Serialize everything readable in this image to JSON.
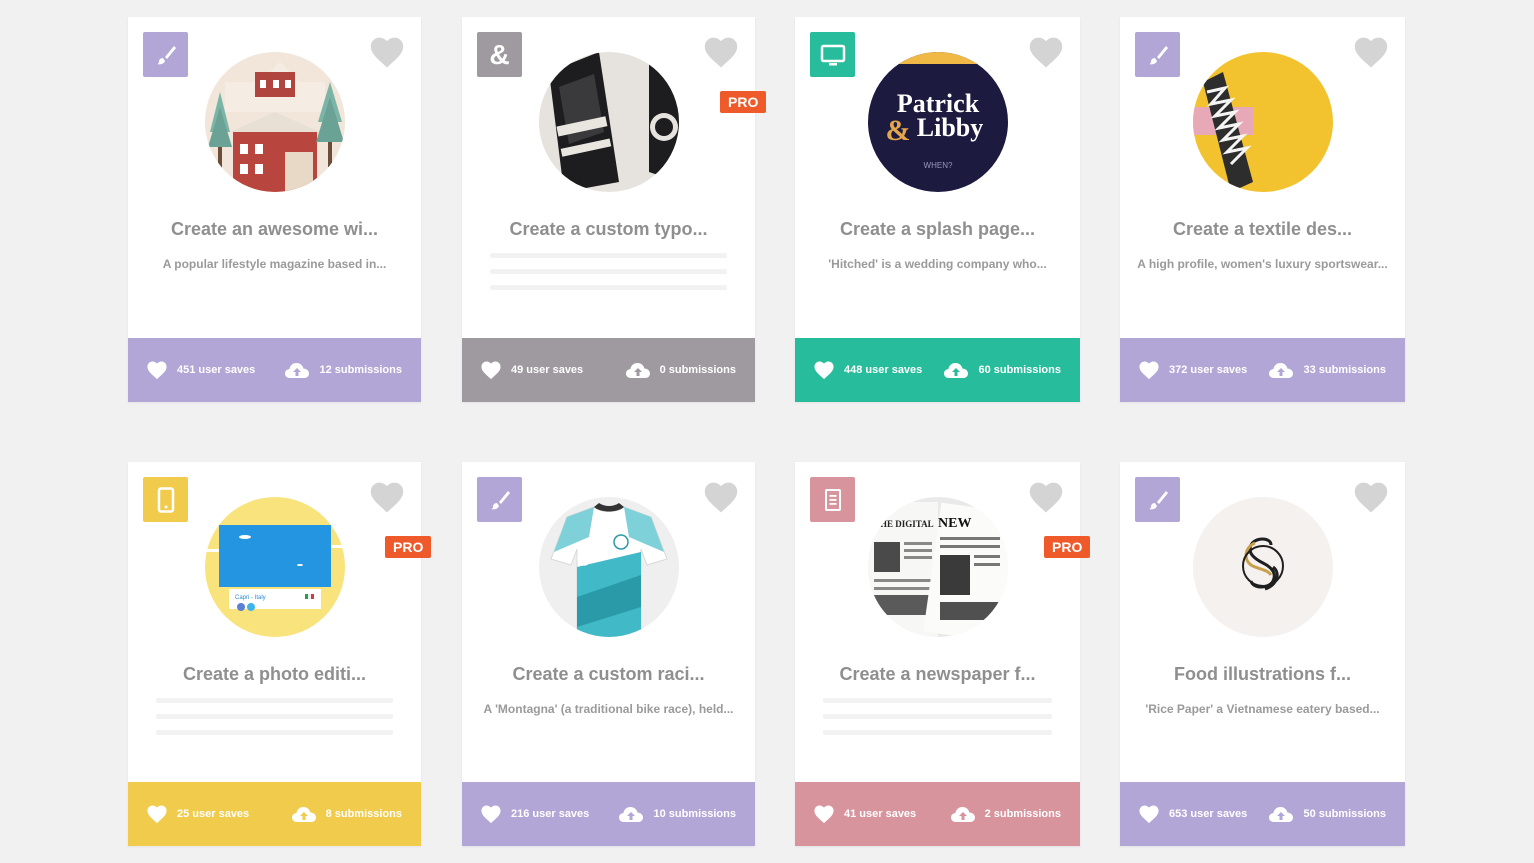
{
  "colors": {
    "purple": "#b2a6d6",
    "gray": "#9e9a9f",
    "teal": "#27bc9b",
    "yellow": "#f1cb4b",
    "pink": "#d7949d",
    "pro_badge": "#ef5a2a",
    "heart_gray": "#d4d4d4"
  },
  "cards": [
    {
      "category": "illustration",
      "category_icon": "brush-icon",
      "title": "Create an awesome wi...",
      "description": "A popular lifestyle magazine based in...",
      "saves": "451 user saves",
      "submissions": "12 submissions",
      "pro": "",
      "color": "purple"
    },
    {
      "category": "typography",
      "category_icon": "ampersand-icon",
      "title": "Create a custom typo...",
      "description": "",
      "saves": "49 user saves",
      "submissions": "0 submissions",
      "pro": "PRO",
      "color": "gray"
    },
    {
      "category": "web",
      "category_icon": "monitor-icon",
      "title": "Create a splash page...",
      "description": "'Hitched' is a wedding company who...",
      "saves": "448 user saves",
      "submissions": "60 submissions",
      "pro": "",
      "color": "teal",
      "thumb_text": {
        "line1": "Patrick",
        "amp": "&",
        "line2": "Libby",
        "small": "WHEN?"
      }
    },
    {
      "category": "illustration",
      "category_icon": "brush-icon",
      "title": "Create a textile des...",
      "description": "A high profile, women's luxury sportswear...",
      "saves": "372 user saves",
      "submissions": "33 submissions",
      "pro": "",
      "color": "purple"
    },
    {
      "category": "mobile",
      "category_icon": "phone-icon",
      "title": "Create a photo editi...",
      "description": "",
      "saves": "25 user saves",
      "submissions": "8 submissions",
      "pro": "PRO",
      "color": "yellow",
      "thumb_text": {
        "caption": "Capri - Italy"
      }
    },
    {
      "category": "illustration",
      "category_icon": "brush-icon",
      "title": "Create a custom raci...",
      "description": "A 'Montagna' (a traditional bike race), held...",
      "saves": "216 user saves",
      "submissions": "10 submissions",
      "pro": "",
      "color": "purple"
    },
    {
      "category": "print",
      "category_icon": "document-icon",
      "title": "Create a newspaper f...",
      "description": "",
      "saves": "41 user saves",
      "submissions": "2 submissions",
      "pro": "PRO",
      "color": "pink",
      "thumb_text": {
        "headline": "NEW",
        "sub": "THE DIGITAL"
      }
    },
    {
      "category": "illustration",
      "category_icon": "brush-icon",
      "title": "Food illustrations f...",
      "description": "'Rice Paper' a Vietnamese eatery based...",
      "saves": "653 user saves",
      "submissions": "50 submissions",
      "pro": "",
      "color": "purple"
    }
  ]
}
